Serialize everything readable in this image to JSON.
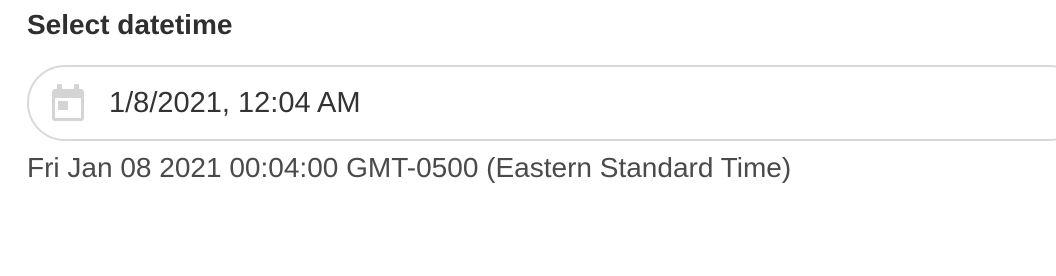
{
  "datetime_field": {
    "label": "Select datetime",
    "value": "1/8/2021, 12:04 AM",
    "icon": "calendar-icon",
    "full_value_text": "Fri Jan 08 2021 00:04:00 GMT-0500 (Eastern Standard Time)"
  },
  "colors": {
    "border": "#d9d9d9",
    "icon": "#d0d0d0",
    "text": "#333333"
  }
}
